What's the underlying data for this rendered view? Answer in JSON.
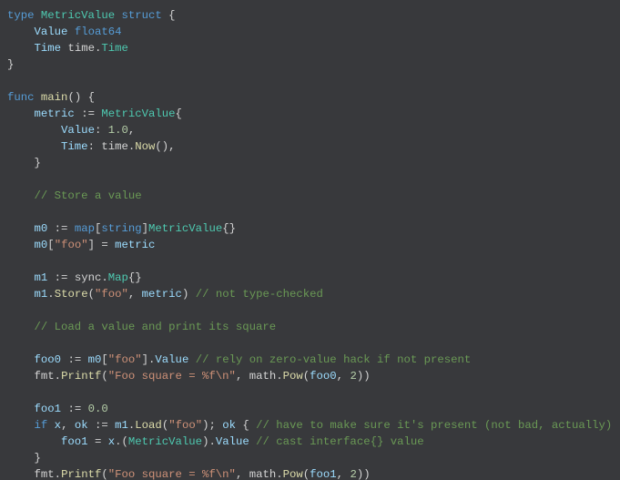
{
  "chart_data": null,
  "code": {
    "lines": [
      {
        "t": "type",
        "indent": 0,
        "tokens": [
          {
            "c": "kw",
            "t": "type "
          },
          {
            "c": "typ",
            "t": "MetricValue"
          },
          {
            "c": "pl",
            "t": " "
          },
          {
            "c": "kw",
            "t": "struct"
          },
          {
            "c": "pl",
            "t": " {"
          }
        ]
      },
      {
        "t": "field",
        "indent": 1,
        "tokens": [
          {
            "c": "fld",
            "t": "Value"
          },
          {
            "c": "pl",
            "t": " "
          },
          {
            "c": "kw",
            "t": "float64"
          }
        ]
      },
      {
        "t": "field",
        "indent": 1,
        "tokens": [
          {
            "c": "fld",
            "t": "Time"
          },
          {
            "c": "pl",
            "t": " time."
          },
          {
            "c": "typ",
            "t": "Time"
          }
        ]
      },
      {
        "t": "close",
        "indent": 0,
        "tokens": [
          {
            "c": "pl",
            "t": "}"
          }
        ]
      },
      {
        "t": "blank",
        "indent": 0,
        "tokens": []
      },
      {
        "t": "func",
        "indent": 0,
        "tokens": [
          {
            "c": "kw",
            "t": "func "
          },
          {
            "c": "fn",
            "t": "main"
          },
          {
            "c": "pl",
            "t": "() {"
          }
        ]
      },
      {
        "t": "stmt",
        "indent": 1,
        "tokens": [
          {
            "c": "fld",
            "t": "metric"
          },
          {
            "c": "pl",
            "t": " := "
          },
          {
            "c": "typ",
            "t": "MetricValue"
          },
          {
            "c": "pl",
            "t": "{"
          }
        ]
      },
      {
        "t": "stmt",
        "indent": 2,
        "tokens": [
          {
            "c": "fld",
            "t": "Value"
          },
          {
            "c": "pl",
            "t": ": "
          },
          {
            "c": "num",
            "t": "1.0"
          },
          {
            "c": "pl",
            "t": ","
          }
        ]
      },
      {
        "t": "stmt",
        "indent": 2,
        "tokens": [
          {
            "c": "fld",
            "t": "Time"
          },
          {
            "c": "pl",
            "t": ": time."
          },
          {
            "c": "fn",
            "t": "Now"
          },
          {
            "c": "pl",
            "t": "(),"
          }
        ]
      },
      {
        "t": "close",
        "indent": 1,
        "tokens": [
          {
            "c": "pl",
            "t": "}"
          }
        ]
      },
      {
        "t": "blank",
        "indent": 0,
        "tokens": []
      },
      {
        "t": "comment",
        "indent": 1,
        "tokens": [
          {
            "c": "com",
            "t": "// Store a value"
          }
        ]
      },
      {
        "t": "blank",
        "indent": 0,
        "tokens": []
      },
      {
        "t": "stmt",
        "indent": 1,
        "tokens": [
          {
            "c": "fld",
            "t": "m0"
          },
          {
            "c": "pl",
            "t": " := "
          },
          {
            "c": "kw",
            "t": "map"
          },
          {
            "c": "pl",
            "t": "["
          },
          {
            "c": "kw",
            "t": "string"
          },
          {
            "c": "pl",
            "t": "]"
          },
          {
            "c": "typ",
            "t": "MetricValue"
          },
          {
            "c": "pl",
            "t": "{}"
          }
        ]
      },
      {
        "t": "stmt",
        "indent": 1,
        "tokens": [
          {
            "c": "fld",
            "t": "m0"
          },
          {
            "c": "pl",
            "t": "["
          },
          {
            "c": "str",
            "t": "\"foo\""
          },
          {
            "c": "pl",
            "t": "] = "
          },
          {
            "c": "fld",
            "t": "metric"
          }
        ]
      },
      {
        "t": "blank",
        "indent": 0,
        "tokens": []
      },
      {
        "t": "stmt",
        "indent": 1,
        "tokens": [
          {
            "c": "fld",
            "t": "m1"
          },
          {
            "c": "pl",
            "t": " := sync."
          },
          {
            "c": "typ",
            "t": "Map"
          },
          {
            "c": "pl",
            "t": "{}"
          }
        ]
      },
      {
        "t": "stmt",
        "indent": 1,
        "tokens": [
          {
            "c": "fld",
            "t": "m1"
          },
          {
            "c": "pl",
            "t": "."
          },
          {
            "c": "fn",
            "t": "Store"
          },
          {
            "c": "pl",
            "t": "("
          },
          {
            "c": "str",
            "t": "\"foo\""
          },
          {
            "c": "pl",
            "t": ", "
          },
          {
            "c": "fld",
            "t": "metric"
          },
          {
            "c": "pl",
            "t": ") "
          },
          {
            "c": "com",
            "t": "// not type-checked"
          }
        ]
      },
      {
        "t": "blank",
        "indent": 0,
        "tokens": []
      },
      {
        "t": "comment",
        "indent": 1,
        "tokens": [
          {
            "c": "com",
            "t": "// Load a value and print its square"
          }
        ]
      },
      {
        "t": "blank",
        "indent": 0,
        "tokens": []
      },
      {
        "t": "stmt",
        "indent": 1,
        "tokens": [
          {
            "c": "fld",
            "t": "foo0"
          },
          {
            "c": "pl",
            "t": " := "
          },
          {
            "c": "fld",
            "t": "m0"
          },
          {
            "c": "pl",
            "t": "["
          },
          {
            "c": "str",
            "t": "\"foo\""
          },
          {
            "c": "pl",
            "t": "]."
          },
          {
            "c": "fld",
            "t": "Value"
          },
          {
            "c": "pl",
            "t": " "
          },
          {
            "c": "com",
            "t": "// rely on zero-value hack if not present"
          }
        ]
      },
      {
        "t": "stmt",
        "indent": 1,
        "tokens": [
          {
            "c": "pl",
            "t": "fmt."
          },
          {
            "c": "fn",
            "t": "Printf"
          },
          {
            "c": "pl",
            "t": "("
          },
          {
            "c": "str",
            "t": "\"Foo square = %f\\n\""
          },
          {
            "c": "pl",
            "t": ", math."
          },
          {
            "c": "fn",
            "t": "Pow"
          },
          {
            "c": "pl",
            "t": "("
          },
          {
            "c": "fld",
            "t": "foo0"
          },
          {
            "c": "pl",
            "t": ", "
          },
          {
            "c": "num",
            "t": "2"
          },
          {
            "c": "pl",
            "t": "))"
          }
        ]
      },
      {
        "t": "blank",
        "indent": 0,
        "tokens": []
      },
      {
        "t": "stmt",
        "indent": 1,
        "tokens": [
          {
            "c": "fld",
            "t": "foo1"
          },
          {
            "c": "pl",
            "t": " := "
          },
          {
            "c": "num",
            "t": "0.0"
          }
        ]
      },
      {
        "t": "stmt",
        "indent": 1,
        "tokens": [
          {
            "c": "kw",
            "t": "if "
          },
          {
            "c": "fld",
            "t": "x"
          },
          {
            "c": "pl",
            "t": ", "
          },
          {
            "c": "fld",
            "t": "ok"
          },
          {
            "c": "pl",
            "t": " := "
          },
          {
            "c": "fld",
            "t": "m1"
          },
          {
            "c": "pl",
            "t": "."
          },
          {
            "c": "fn",
            "t": "Load"
          },
          {
            "c": "pl",
            "t": "("
          },
          {
            "c": "str",
            "t": "\"foo\""
          },
          {
            "c": "pl",
            "t": "); "
          },
          {
            "c": "fld",
            "t": "ok"
          },
          {
            "c": "pl",
            "t": " { "
          },
          {
            "c": "com",
            "t": "// have to make sure it's present (not bad, actually)"
          }
        ]
      },
      {
        "t": "stmt",
        "indent": 2,
        "tokens": [
          {
            "c": "fld",
            "t": "foo1"
          },
          {
            "c": "pl",
            "t": " = "
          },
          {
            "c": "fld",
            "t": "x"
          },
          {
            "c": "pl",
            "t": ".("
          },
          {
            "c": "typ",
            "t": "MetricValue"
          },
          {
            "c": "pl",
            "t": ")."
          },
          {
            "c": "fld",
            "t": "Value"
          },
          {
            "c": "pl",
            "t": " "
          },
          {
            "c": "com",
            "t": "// cast interface{} value"
          }
        ]
      },
      {
        "t": "close",
        "indent": 1,
        "tokens": [
          {
            "c": "pl",
            "t": "}"
          }
        ]
      },
      {
        "t": "stmt",
        "indent": 1,
        "tokens": [
          {
            "c": "pl",
            "t": "fmt."
          },
          {
            "c": "fn",
            "t": "Printf"
          },
          {
            "c": "pl",
            "t": "("
          },
          {
            "c": "str",
            "t": "\"Foo square = %f\\n\""
          },
          {
            "c": "pl",
            "t": ", math."
          },
          {
            "c": "fn",
            "t": "Pow"
          },
          {
            "c": "pl",
            "t": "("
          },
          {
            "c": "fld",
            "t": "foo1"
          },
          {
            "c": "pl",
            "t": ", "
          },
          {
            "c": "num",
            "t": "2"
          },
          {
            "c": "pl",
            "t": "))"
          }
        ]
      }
    ]
  }
}
